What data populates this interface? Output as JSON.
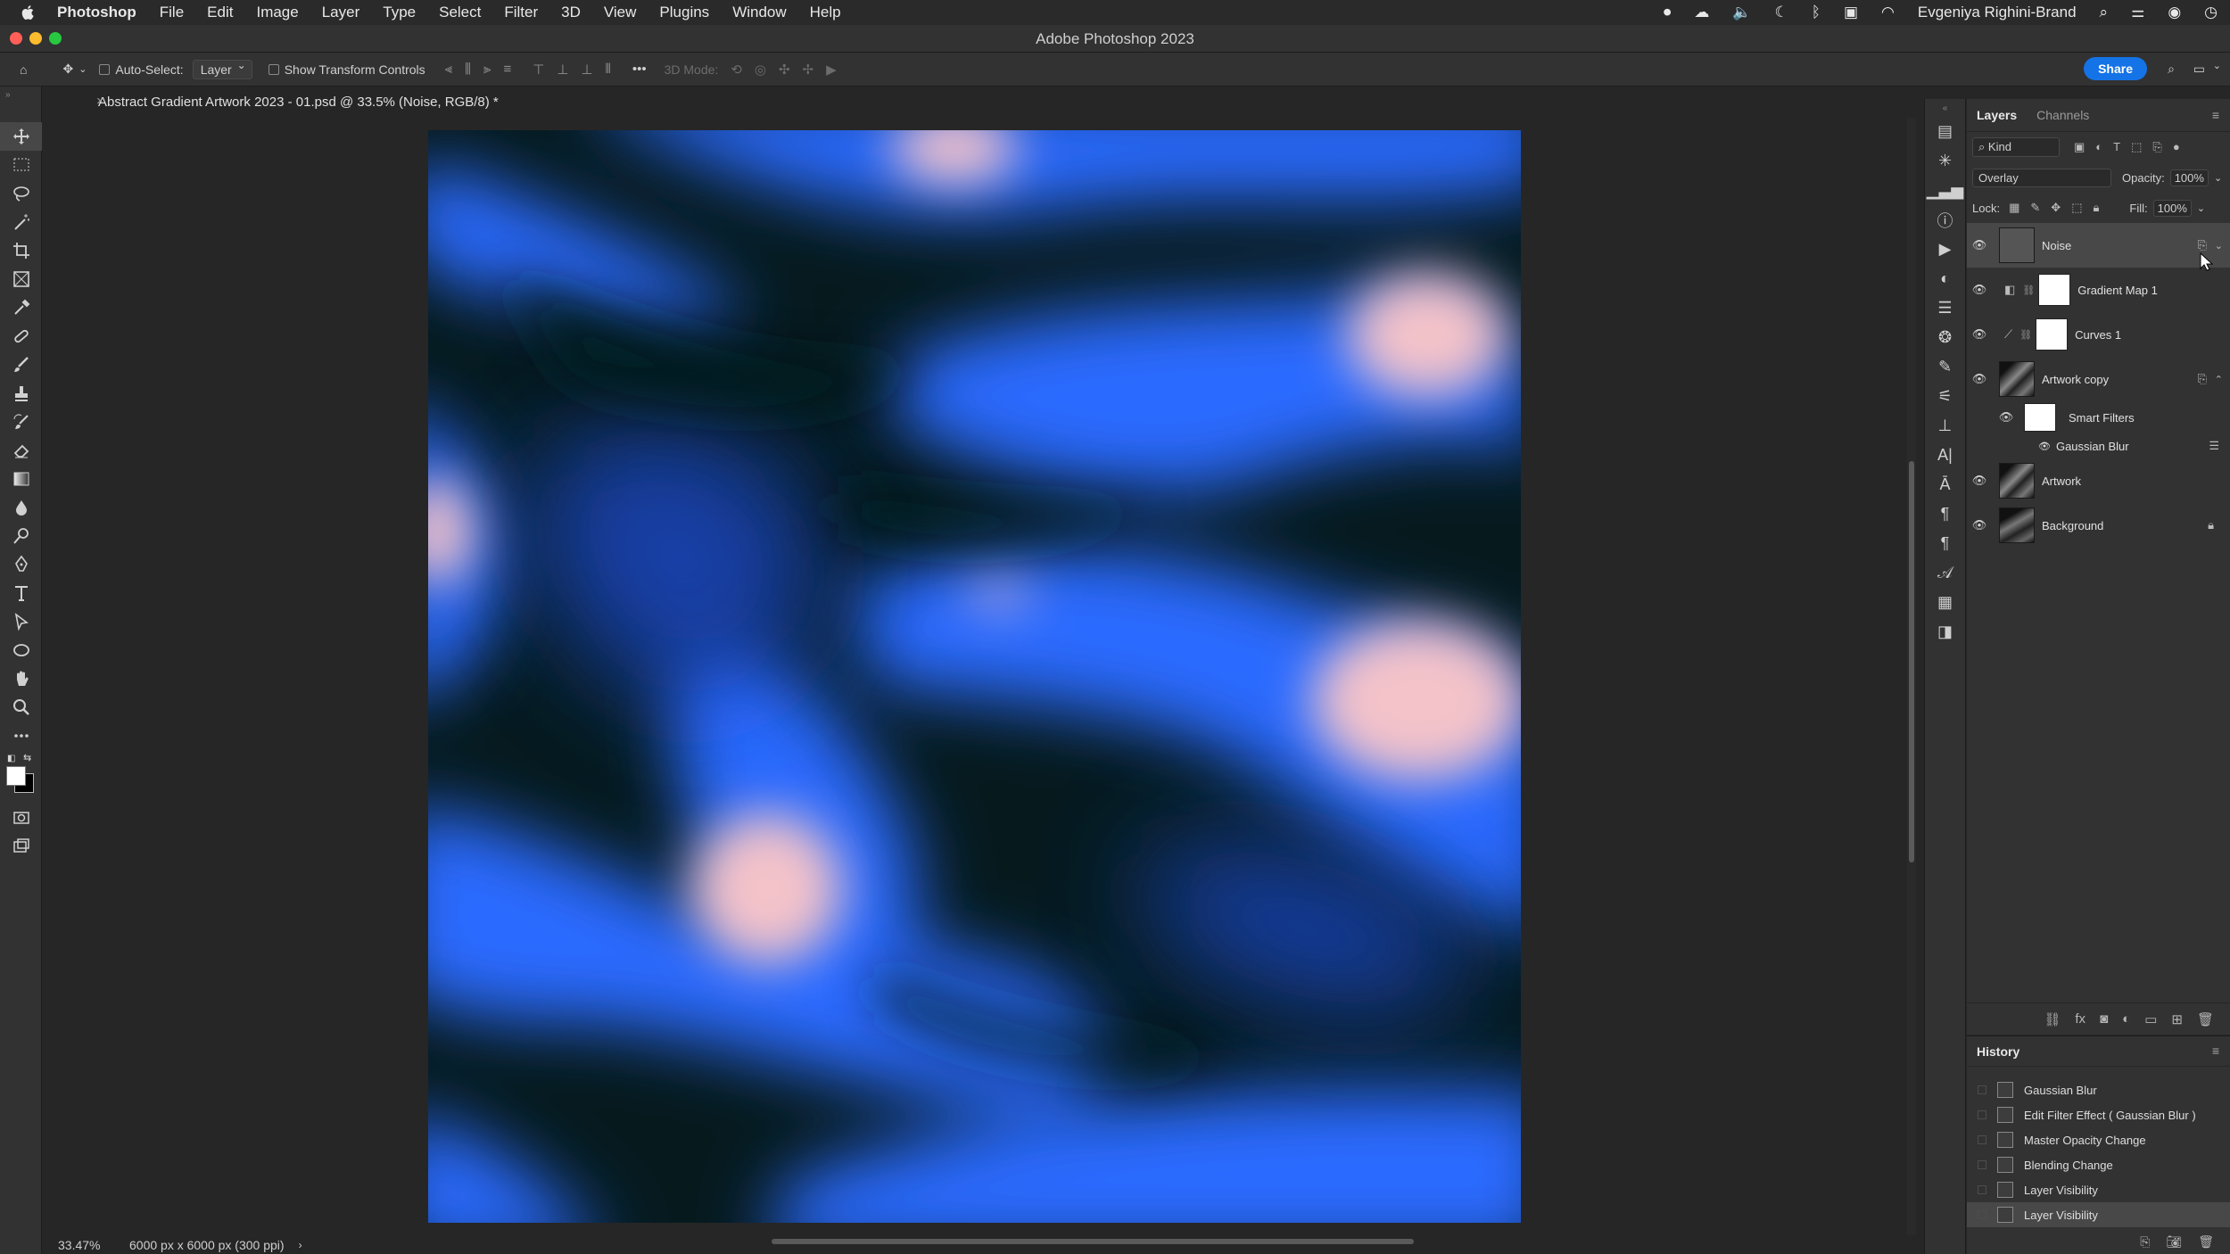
{
  "menubar": {
    "app_name": "Photoshop",
    "items": [
      "File",
      "Edit",
      "Image",
      "Layer",
      "Type",
      "Select",
      "Filter",
      "3D",
      "View",
      "Plugins",
      "Window",
      "Help"
    ],
    "user": "Evgeniya Righini-Brand"
  },
  "window": {
    "title": "Adobe Photoshop 2023"
  },
  "options": {
    "auto_select_label": "Auto-Select:",
    "auto_select_value": "Layer",
    "show_transform_label": "Show Transform Controls",
    "mode_3d_label": "3D Mode:",
    "share_label": "Share"
  },
  "document": {
    "tab_title": "Abstract Gradient Artwork 2023 - 01.psd @ 33.5% (Noise, RGB/8) *",
    "zoom": "33.47%",
    "dimensions": "6000 px x 6000 px (300 ppi)"
  },
  "colors": {
    "accent": "#1473e6",
    "art_blue": "#2a6bff",
    "art_pink": "#f4c3c9",
    "art_dark": "#061a1e"
  },
  "layers_panel": {
    "tabs": [
      "Layers",
      "Channels"
    ],
    "kind_label": "Kind",
    "blend_mode": "Overlay",
    "opacity_label": "Opacity:",
    "opacity_value": "100%",
    "lock_label": "Lock:",
    "fill_label": "Fill:",
    "fill_value": "100%",
    "layers": [
      {
        "name": "Noise"
      },
      {
        "name": "Gradient Map 1"
      },
      {
        "name": "Curves 1"
      },
      {
        "name": "Artwork copy"
      },
      {
        "name": "Smart Filters"
      },
      {
        "name": "Gaussian Blur"
      },
      {
        "name": "Artwork"
      },
      {
        "name": "Background"
      }
    ]
  },
  "history_panel": {
    "title": "History",
    "items": [
      "Gaussian Blur",
      "Edit Filter Effect ( Gaussian Blur )",
      "Master Opacity Change",
      "Blending Change",
      "Layer Visibility",
      "Layer Visibility"
    ]
  }
}
